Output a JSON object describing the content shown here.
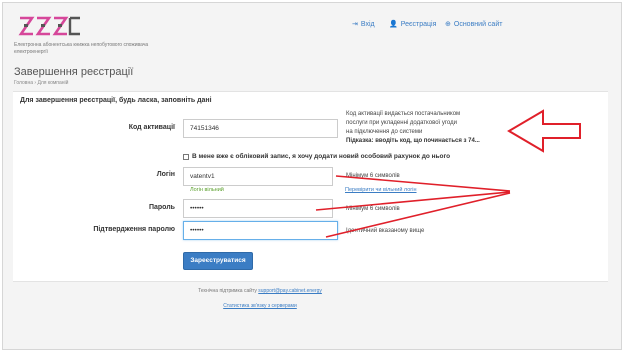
{
  "header": {
    "logo_subtitle": "Електронна абонентська книжка непобутового споживача електроенергії",
    "nav": [
      {
        "label": "Вхід",
        "icon": "login-icon"
      },
      {
        "label": "Реєстрація",
        "icon": "user-add-icon"
      },
      {
        "label": "Основний сайт",
        "icon": "globe-icon"
      }
    ]
  },
  "page": {
    "title": "Завершення реєстрації",
    "breadcrumb": "Головна › Для компаній",
    "intro": "Для завершення реєстрації, будь ласка, заповніть дані"
  },
  "form": {
    "activation": {
      "label": "Код активації",
      "value": "74151346",
      "help_line1": "Код активації видається постачальником",
      "help_line2": "послуги при укладенні додаткової угоди",
      "help_line3": "на підключення до системи",
      "hint": "Підказка: вводіть код, що починається з 74..."
    },
    "existing_account_checkbox": "В мене вже є обліковий запис, я хочу додати новий особовий рахунок до нього",
    "login": {
      "label": "Логін",
      "value": "vatentv1",
      "help": "Мінімум 6 символів",
      "status": "Логін вільний",
      "check_link": "Перевірити чи вільний логін"
    },
    "password": {
      "label": "Пароль",
      "value": "••••••",
      "help": "Мінімум 6 символів"
    },
    "password_confirm": {
      "label": "Підтвердження паролю",
      "value": "••••••",
      "help": "Ідентичний вказаному вище"
    },
    "submit": "Зареєструватися"
  },
  "footer": {
    "support_prefix": "Технічна підтримка сайту",
    "support_email": "support@pay.cabinet.energy",
    "stats_link": "Статистика зв'язку з серверами"
  },
  "colors": {
    "accent": "#3b7dc4",
    "annotation": "#e0202a",
    "logo": "#d6479a",
    "success": "#5aa02c"
  }
}
